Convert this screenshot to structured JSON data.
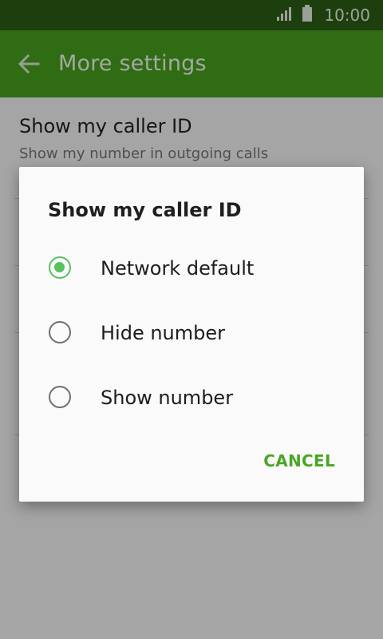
{
  "status_bar": {
    "time": "10:00",
    "icons": [
      "signal-icon",
      "battery-icon"
    ]
  },
  "app_bar": {
    "title": "More settings",
    "back_icon": "back-arrow-icon"
  },
  "settings": {
    "caller_id": {
      "title": "Show my caller ID",
      "subtitle": "Show my number in outgoing calls"
    }
  },
  "dialog": {
    "title": "Show my caller ID",
    "options": [
      {
        "label": "Network default",
        "selected": true
      },
      {
        "label": "Hide number",
        "selected": false
      },
      {
        "label": "Show number",
        "selected": false
      }
    ],
    "cancel_label": "CANCEL"
  },
  "colors": {
    "status_bar": "#2c5f14",
    "app_bar": "#47a11f",
    "accent": "#57c25e",
    "cancel_text": "#4aa626"
  }
}
